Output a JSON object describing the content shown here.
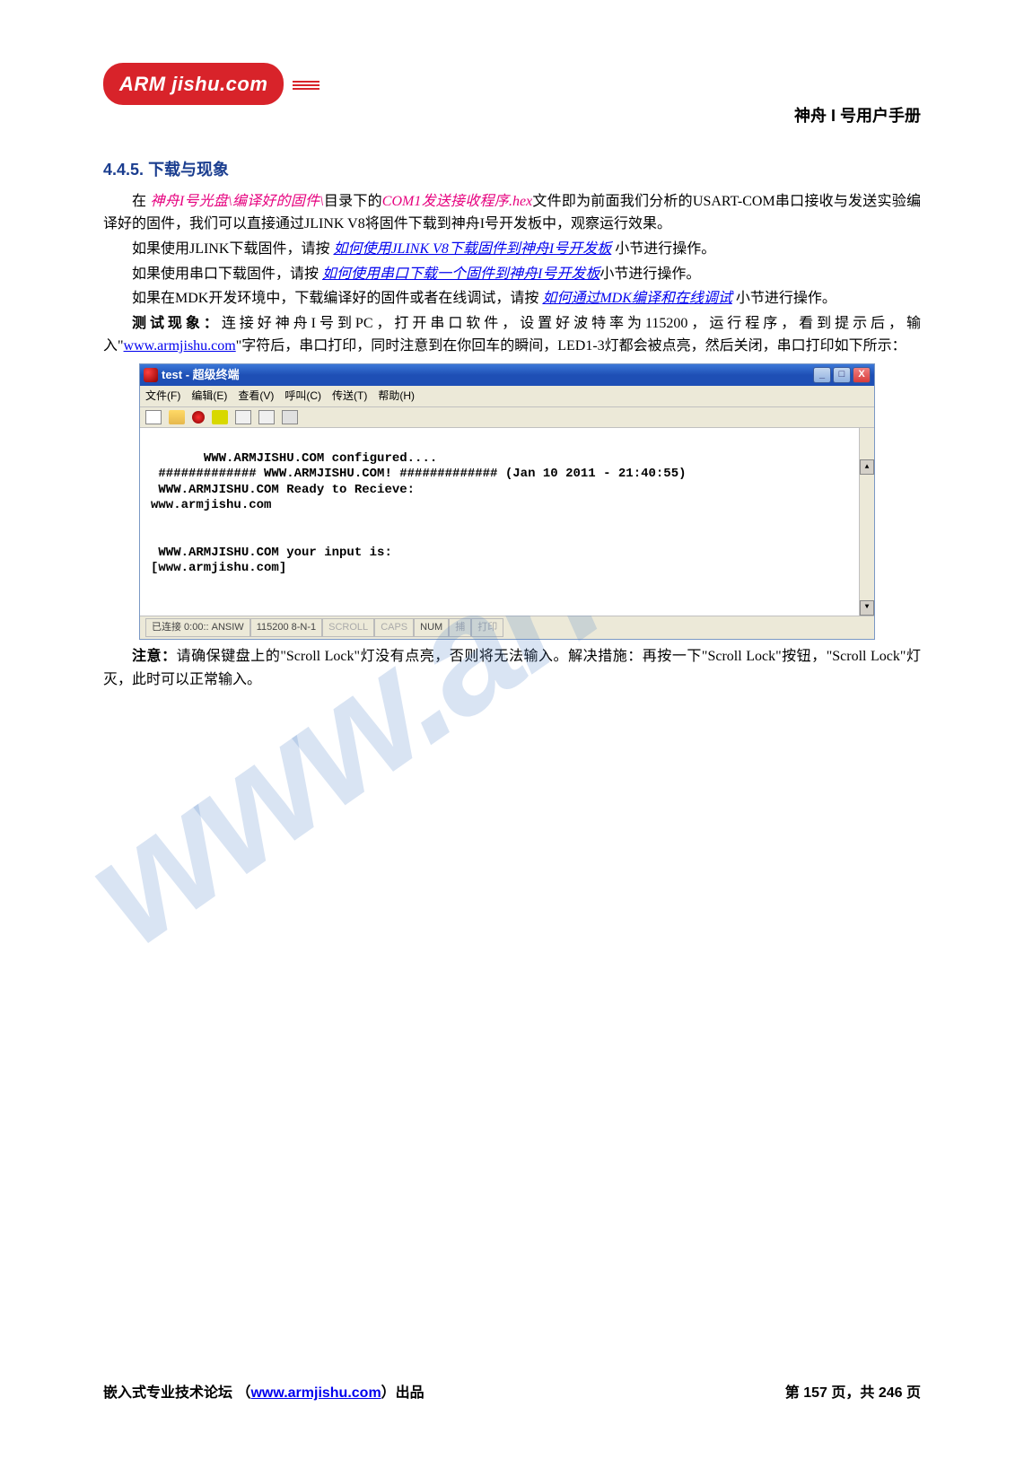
{
  "header": {
    "logo_text": "ARM jishu.com",
    "manual_title": "神舟 I 号用户手册"
  },
  "section": {
    "number": "4.4.5.",
    "title": "下载与现象"
  },
  "body": {
    "p1_prefix": "在 ",
    "p1_path": "神舟I号光盘\\编译好的固件\\",
    "p1_mid": "目录下的",
    "p1_file": "COM1发送接收程序.hex",
    "p1_suffix": "文件即为前面我们分析的USART-COM串口接收与发送实验编译好的固件，我们可以直接通过JLINK V8将固件下载到神舟I号开发板中，观察运行效果。",
    "p2_prefix": "如果使用JLINK下载固件，请按 ",
    "p2_link": "如何使用JLINK V8下载固件到神舟I号开发板",
    "p2_suffix": " 小节进行操作。",
    "p3_prefix": "如果使用串口下载固件，请按 ",
    "p3_link": "如何使用串口下载一个固件到神舟I号开发板",
    "p3_suffix": "小节进行操作。",
    "p4_prefix": "如果在MDK开发环境中，下载编译好的固件或者在线调试，请按 ",
    "p4_link": "如何通过MDK编译和在线调试",
    "p4_suffix": " 小节进行操作。",
    "test_label": "测试现象：",
    "test_text_a": "连接好神舟I号到PC，打开串口软件，设置好波特率为115200，运行程序，看到提示后，输入\"",
    "test_link": "www.armjishu.com",
    "test_text_b": "\"字符后，串口打印，同时注意到在你回车的瞬间，LED1-3灯都会被点亮，然后关闭，串口打印如下所示：",
    "note_label": "注意：",
    "note_text": "请确保键盘上的\"Scroll Lock\"灯没有点亮，否则将无法输入。解决措施：再按一下\"Scroll Lock\"按钮，\"Scroll Lock\"灯灭，此时可以正常输入。"
  },
  "terminal": {
    "title": "test - 超级终端",
    "menu": {
      "file": "文件(F)",
      "edit": "编辑(E)",
      "view": "查看(V)",
      "call": "呼叫(C)",
      "transfer": "传送(T)",
      "help": "帮助(H)"
    },
    "output": " WWW.ARMJISHU.COM configured....\n ############# WWW.ARMJISHU.COM! ############# (Jan 10 2011 - 21:40:55)\n WWW.ARMJISHU.COM Ready to Recieve:\nwww.armjishu.com\n\n\n WWW.ARMJISHU.COM your input is:\n[www.armjishu.com]",
    "status": {
      "connected": "已连接 0:00:: ANSIW",
      "port": "115200 8-N-1",
      "scroll": "SCROLL",
      "caps": "CAPS",
      "num": "NUM",
      "capture": "捕",
      "print": "打印"
    }
  },
  "watermark": "www.arm",
  "footer": {
    "left_a": "嵌入式专业技术论坛 （",
    "left_link": "www.armjishu.com",
    "left_b": "）出品",
    "right_a": "第 ",
    "page_cur": "157",
    "right_b": " 页，共 ",
    "page_total": "246",
    "right_c": " 页"
  }
}
